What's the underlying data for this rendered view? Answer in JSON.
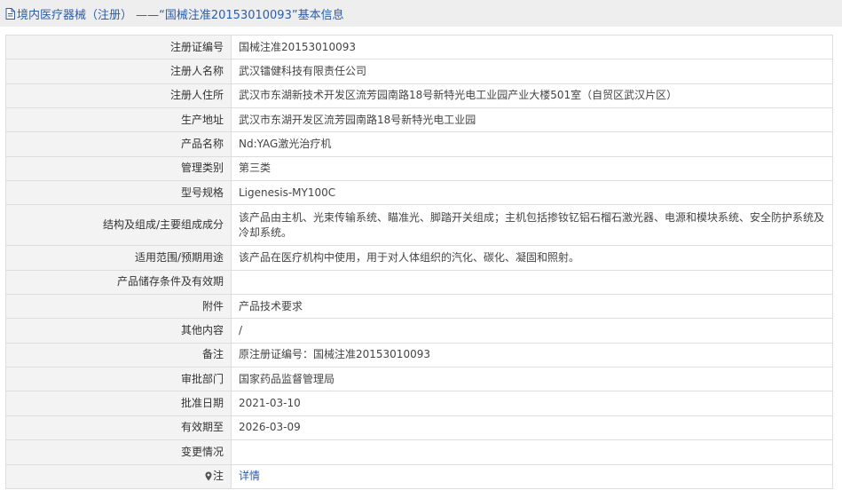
{
  "header": {
    "icon": "document-icon",
    "title": "境内医疗器械（注册） ——“国械注准20153010093”基本信息"
  },
  "rows": [
    {
      "label": "注册证编号",
      "value": "国械注准20153010093"
    },
    {
      "label": "注册人名称",
      "value": "武汉镭健科技有限责任公司"
    },
    {
      "label": "注册人住所",
      "value": "武汉市东湖新技术开发区流芳园南路18号新特光电工业园产业大楼501室（自贸区武汉片区）"
    },
    {
      "label": "生产地址",
      "value": "武汉市东湖开发区流芳园南路18号新特光电工业园"
    },
    {
      "label": "产品名称",
      "value": "Nd:YAG激光治疗机"
    },
    {
      "label": "管理类别",
      "value": "第三类"
    },
    {
      "label": "型号规格",
      "value": "Ligenesis-MY100C"
    },
    {
      "label": "结构及组成/主要组成成分",
      "value": "该产品由主机、光束传输系统、瞄准光、脚踏开关组成；主机包括掺钕钇铝石榴石激光器、电源和模块系统、安全防护系统及冷却系统。"
    },
    {
      "label": "适用范围/预期用途",
      "value": "该产品在医疗机构中使用，用于对人体组织的汽化、碳化、凝固和照射。"
    },
    {
      "label": "产品储存条件及有效期",
      "value": ""
    },
    {
      "label": "附件",
      "value": "产品技术要求"
    },
    {
      "label": "其他内容",
      "value": "/"
    },
    {
      "label": "备注",
      "value": "原注册证编号：国械注准20153010093"
    },
    {
      "label": "审批部门",
      "value": "国家药品监督管理局"
    },
    {
      "label": "批准日期",
      "value": "2021-03-10"
    },
    {
      "label": "有效期至",
      "value": "2026-03-09"
    },
    {
      "label": "变更情况",
      "value": ""
    }
  ],
  "note": {
    "icon": "map-pin-icon",
    "label": "注",
    "link": "详情"
  },
  "colors": {
    "link": "#2a5dad",
    "label_bg": "#f3f3f3",
    "border": "#dddddd",
    "header_bg": "#eeeeee"
  }
}
